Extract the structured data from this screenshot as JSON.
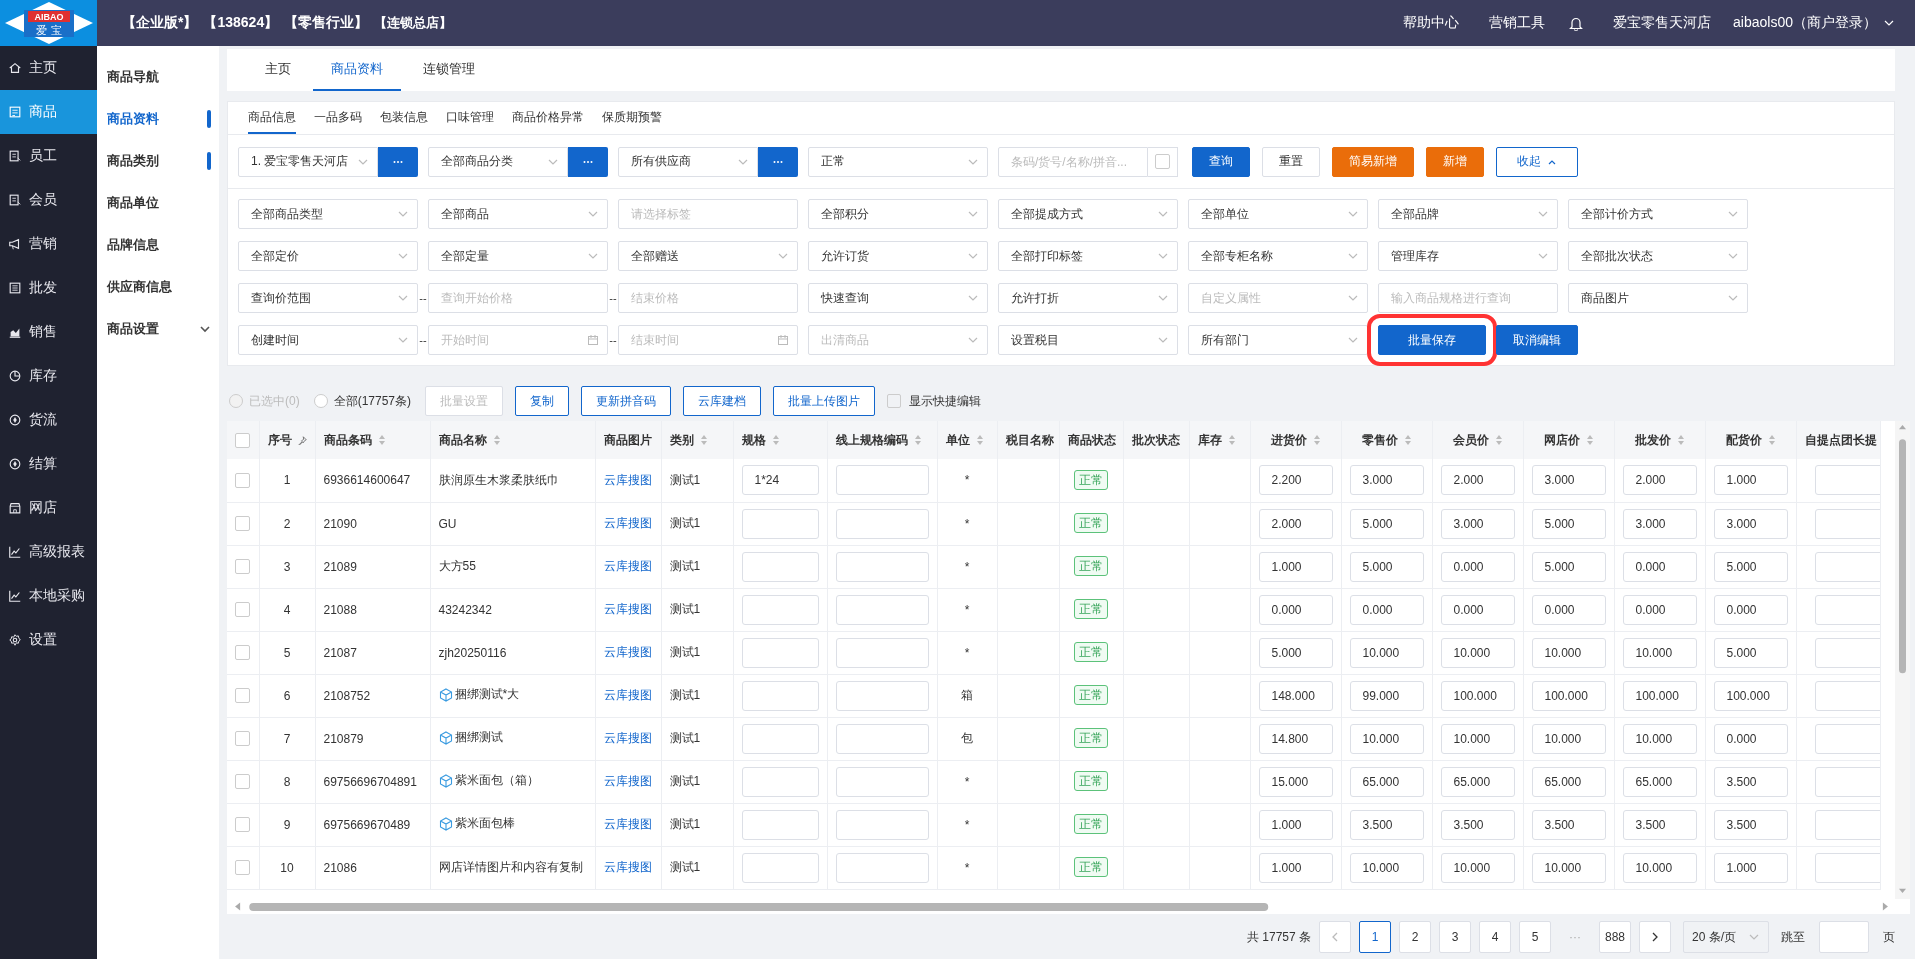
{
  "logo": {
    "text": "AIBAO",
    "subtext": "爱 宝"
  },
  "header": {
    "edition": "【企业版*】",
    "account": "【138624】",
    "industry": "【零售行业】",
    "store_type": "【连锁总店】",
    "links": [
      "帮助中心",
      "营销工具"
    ],
    "store": "爱宝零售天河店",
    "user": "aibaols00（商户登录）"
  },
  "sidebar": {
    "items": [
      {
        "label": "主页",
        "selected": false
      },
      {
        "label": "商品",
        "selected": true
      },
      {
        "label": "员工",
        "selected": false
      },
      {
        "label": "会员",
        "selected": false
      },
      {
        "label": "营销",
        "selected": false
      },
      {
        "label": "批发",
        "selected": false
      },
      {
        "label": "销售",
        "selected": false
      },
      {
        "label": "库存",
        "selected": false
      },
      {
        "label": "货流",
        "selected": false
      },
      {
        "label": "结算",
        "selected": false
      },
      {
        "label": "网店",
        "selected": false
      },
      {
        "label": "高级报表",
        "selected": false
      },
      {
        "label": "本地采购",
        "selected": false
      },
      {
        "label": "设置",
        "selected": false
      }
    ]
  },
  "subnav": {
    "items": [
      {
        "label": "商品导航",
        "kind": "link",
        "selected": false,
        "marked": false
      },
      {
        "label": "商品资料",
        "kind": "link",
        "selected": true,
        "marked": true
      },
      {
        "label": "商品类别",
        "kind": "link",
        "selected": false,
        "marked": true
      },
      {
        "label": "商品单位",
        "kind": "link",
        "selected": false,
        "marked": false
      },
      {
        "label": "品牌信息",
        "kind": "link",
        "selected": false,
        "marked": false
      },
      {
        "label": "供应商信息",
        "kind": "link",
        "selected": false,
        "marked": false
      },
      {
        "label": "商品设置",
        "kind": "group",
        "selected": false,
        "marked": false,
        "expanded": false
      }
    ]
  },
  "tabs": [
    {
      "label": "主页",
      "selected": false
    },
    {
      "label": "商品资料",
      "selected": true
    },
    {
      "label": "连锁管理",
      "selected": false
    }
  ],
  "subtabs": [
    {
      "label": "商品信息",
      "selected": true
    },
    {
      "label": "一品多码",
      "selected": false
    },
    {
      "label": "包装信息",
      "selected": false
    },
    {
      "label": "口味管理",
      "selected": false
    },
    {
      "label": "商品价格异常",
      "selected": false
    },
    {
      "label": "保质期预警",
      "selected": false
    }
  ],
  "query_bar": {
    "fields": [
      {
        "kind": "picker",
        "value": "1. 爱宝零售天河店"
      },
      {
        "kind": "picker",
        "value": "全部商品分类"
      },
      {
        "kind": "picker",
        "value": "所有供应商"
      },
      {
        "kind": "select",
        "value": "正常"
      },
      {
        "kind": "search",
        "placeholder": "条码/货号/名称/拼音...",
        "checked": false
      }
    ],
    "buttons": [
      {
        "label": "查询",
        "kind": "primary"
      },
      {
        "label": "重置",
        "kind": "plain"
      },
      {
        "label": "简易新增",
        "kind": "warning"
      },
      {
        "label": "新增",
        "kind": "warning"
      },
      {
        "label": "收起",
        "kind": "collapse"
      }
    ]
  },
  "filters": {
    "rows": [
      [
        {
          "kind": "select",
          "value": "全部商品类型"
        },
        {
          "kind": "select",
          "value": "全部商品"
        },
        {
          "kind": "input",
          "placeholder": "请选择标签"
        },
        {
          "kind": "select",
          "value": "全部积分"
        },
        {
          "kind": "select",
          "value": "全部提成方式"
        },
        {
          "kind": "select",
          "value": "全部单位"
        },
        {
          "kind": "select",
          "value": "全部品牌"
        },
        {
          "kind": "select",
          "value": "全部计价方式"
        }
      ],
      [
        {
          "kind": "select",
          "value": "全部定价"
        },
        {
          "kind": "select",
          "value": "全部定量"
        },
        {
          "kind": "select",
          "value": "全部赠送"
        },
        {
          "kind": "select",
          "value": "允许订货"
        },
        {
          "kind": "select",
          "value": "全部打印标签"
        },
        {
          "kind": "select",
          "value": "全部专柜名称"
        },
        {
          "kind": "select",
          "value": "管理库存"
        },
        {
          "kind": "select",
          "value": "全部批次状态"
        }
      ],
      [
        {
          "kind": "select",
          "value": "查询价范围"
        },
        {
          "kind": "input",
          "prefix": "--",
          "placeholder": "查询开始价格"
        },
        {
          "kind": "input",
          "prefix": "--",
          "placeholder": "结束价格"
        },
        {
          "kind": "select",
          "value": "快速查询"
        },
        {
          "kind": "select",
          "value": "允许打折"
        },
        {
          "kind": "select",
          "placeholder": "自定义属性"
        },
        {
          "kind": "input",
          "placeholder": "输入商品规格进行查询"
        },
        {
          "kind": "select",
          "value": "商品图片"
        }
      ],
      [
        {
          "kind": "select",
          "value": "创建时间"
        },
        {
          "kind": "date",
          "prefix": "--",
          "placeholder": "开始时间"
        },
        {
          "kind": "date",
          "prefix": "--",
          "placeholder": "结束时间"
        },
        {
          "kind": "select",
          "placeholder": "出清商品"
        },
        {
          "kind": "select",
          "value": "设置税目"
        },
        {
          "kind": "select",
          "value": "所有部门"
        },
        {
          "kind": "button",
          "label": "批量保存",
          "highlighted": true
        },
        {
          "kind": "button",
          "label": "取消编辑",
          "highlighted": false
        }
      ]
    ]
  },
  "actions": {
    "selection": [
      {
        "label": "已选中(0)",
        "selected": false,
        "disabled": true
      },
      {
        "label": "全部(17757条)",
        "selected": false,
        "disabled": false
      }
    ],
    "buttons": [
      {
        "label": "批量设置",
        "disabled": true
      },
      {
        "label": "复制",
        "disabled": false
      },
      {
        "label": "更新拼音码",
        "disabled": false
      },
      {
        "label": "云库建档",
        "disabled": false
      },
      {
        "label": "批量上传图片",
        "disabled": false
      }
    ],
    "quick_edit": {
      "label": "显示快捷编辑",
      "checked": false
    }
  },
  "table": {
    "header_checked": false,
    "columns": [
      {
        "label": "序号",
        "kind": "pin"
      },
      {
        "label": "商品条码",
        "kind": "sort"
      },
      {
        "label": "商品名称",
        "kind": "sort"
      },
      {
        "label": "商品图片",
        "kind": "plain"
      },
      {
        "label": "类别",
        "kind": "sort"
      },
      {
        "label": "规格",
        "kind": "sort"
      },
      {
        "label": "线上规格编码",
        "kind": "sort"
      },
      {
        "label": "单位",
        "kind": "sort"
      },
      {
        "label": "税目名称",
        "kind": "plain"
      },
      {
        "label": "商品状态",
        "kind": "plain"
      },
      {
        "label": "批次状态",
        "kind": "plain"
      },
      {
        "label": "库存",
        "kind": "sort"
      },
      {
        "label": "进货价",
        "kind": "sort"
      },
      {
        "label": "零售价",
        "kind": "sort"
      },
      {
        "label": "会员价",
        "kind": "sort"
      },
      {
        "label": "网店价",
        "kind": "sort"
      },
      {
        "label": "批发价",
        "kind": "sort"
      },
      {
        "label": "配货价",
        "kind": "sort"
      },
      {
        "label": "自提点团长提",
        "kind": "plain"
      }
    ],
    "rows": [
      {
        "checked": false,
        "no": "1",
        "code": "6936614600647",
        "name": "肤润原生木浆柔肤纸巾",
        "bundle": false,
        "image_link": "云库搜图",
        "category": "测试1",
        "spec": "1*24",
        "unit": "*",
        "status": "正常",
        "prices": [
          "2.200",
          "3.000",
          "2.000",
          "3.000",
          "2.000",
          "1.000"
        ]
      },
      {
        "checked": false,
        "no": "2",
        "code": "21090",
        "name": "GU",
        "bundle": false,
        "image_link": "云库搜图",
        "category": "测试1",
        "unit": "*",
        "status": "正常",
        "prices": [
          "2.000",
          "5.000",
          "3.000",
          "5.000",
          "3.000",
          "3.000"
        ]
      },
      {
        "checked": false,
        "no": "3",
        "code": "21089",
        "name": "大方55",
        "bundle": false,
        "image_link": "云库搜图",
        "category": "测试1",
        "unit": "*",
        "status": "正常",
        "prices": [
          "1.000",
          "5.000",
          "0.000",
          "5.000",
          "0.000",
          "5.000"
        ]
      },
      {
        "checked": false,
        "no": "4",
        "code": "21088",
        "name": "43242342",
        "bundle": false,
        "image_link": "云库搜图",
        "category": "测试1",
        "unit": "*",
        "status": "正常",
        "prices": [
          "0.000",
          "0.000",
          "0.000",
          "0.000",
          "0.000",
          "0.000"
        ]
      },
      {
        "checked": false,
        "no": "5",
        "code": "21087",
        "name": "zjh20250116",
        "bundle": false,
        "image_link": "云库搜图",
        "category": "测试1",
        "unit": "*",
        "status": "正常",
        "prices": [
          "5.000",
          "10.000",
          "10.000",
          "10.000",
          "10.000",
          "5.000"
        ]
      },
      {
        "checked": false,
        "no": "6",
        "code": "2108752",
        "name": "捆绑测试*大",
        "bundle": true,
        "image_link": "云库搜图",
        "category": "测试1",
        "unit": "箱",
        "status": "正常",
        "prices": [
          "148.000",
          "99.000",
          "100.000",
          "100.000",
          "100.000",
          "100.000"
        ]
      },
      {
        "checked": false,
        "no": "7",
        "code": "210879",
        "name": "捆绑测试",
        "bundle": true,
        "image_link": "云库搜图",
        "category": "测试1",
        "unit": "包",
        "status": "正常",
        "prices": [
          "14.800",
          "10.000",
          "10.000",
          "10.000",
          "10.000",
          "0.000"
        ]
      },
      {
        "checked": false,
        "no": "8",
        "code": "69756696704891",
        "name": "紫米面包（箱）",
        "bundle": true,
        "image_link": "云库搜图",
        "category": "测试1",
        "unit": "*",
        "status": "正常",
        "prices": [
          "15.000",
          "65.000",
          "65.000",
          "65.000",
          "65.000",
          "3.500"
        ]
      },
      {
        "checked": false,
        "no": "9",
        "code": "6975669670489",
        "name": "紫米面包棒",
        "bundle": true,
        "image_link": "云库搜图",
        "category": "测试1",
        "unit": "*",
        "status": "正常",
        "prices": [
          "1.000",
          "3.500",
          "3.500",
          "3.500",
          "3.500",
          "3.500"
        ]
      },
      {
        "checked": false,
        "no": "10",
        "code": "21086",
        "name": "网店详情图片和内容有复制",
        "bundle": false,
        "image_link": "云库搜图",
        "category": "测试1",
        "unit": "*",
        "status": "正常",
        "prices": [
          "1.000",
          "10.000",
          "10.000",
          "10.000",
          "10.000",
          "1.000"
        ]
      }
    ]
  },
  "pagination": {
    "total": "共 17757 条",
    "pages": [
      {
        "label": "1",
        "kind": "page",
        "selected": true
      },
      {
        "label": "2",
        "kind": "page",
        "selected": false
      },
      {
        "label": "3",
        "kind": "page",
        "selected": false
      },
      {
        "label": "4",
        "kind": "page",
        "selected": false
      },
      {
        "label": "5",
        "kind": "page",
        "selected": false
      },
      {
        "label": "···",
        "kind": "ellipsis",
        "selected": false
      },
      {
        "label": "888",
        "kind": "page",
        "selected": false
      }
    ],
    "page_size": "20 条/页",
    "jump_label": "跳至",
    "page_suffix": "页"
  }
}
